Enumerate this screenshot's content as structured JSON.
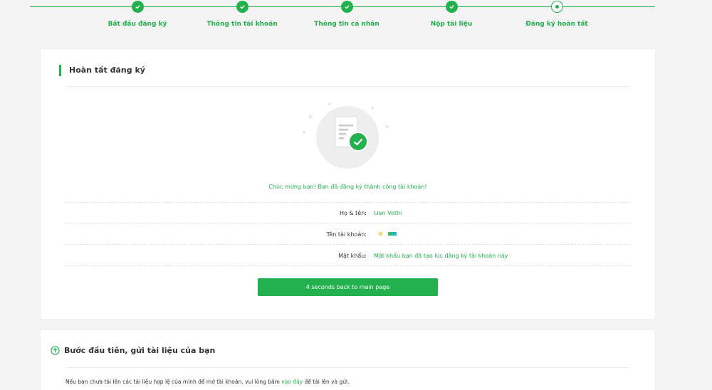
{
  "stepper": {
    "steps": [
      {
        "label": "Bắt đầu đăng ký",
        "status": "done"
      },
      {
        "label": "Thông tin tài khoản",
        "status": "done"
      },
      {
        "label": "Thông tin cá nhân",
        "status": "done"
      },
      {
        "label": "Nộp tài liệu",
        "status": "done"
      },
      {
        "label": "Đăng ký hoàn tất",
        "status": "current"
      }
    ]
  },
  "complete": {
    "title": "Hoàn tất đăng ký",
    "message": "Chúc mừng bạn! Bạn đã đăng ký thành công tài khoản!",
    "fields": [
      {
        "label": "Họ & tên:",
        "value": "Lien Vothi"
      },
      {
        "label": "Tên tài khoản:",
        "value": ""
      },
      {
        "label": "Mật khẩu:",
        "value": "Mật khẩu bạn đã tạo lúc đăng ký tài khoản này"
      }
    ],
    "redirect_button": "4 seconds back to main page"
  },
  "next_step": {
    "title": "Bước đầu tiên, gửi tài liệu của bạn",
    "note_before": "Nếu bạn chưa tải lên các tài liệu hợp lệ của mình để mở tài khoản, vui lòng bấm ",
    "note_link": "vào đây",
    "note_after": " để tải lên và gửi."
  },
  "colors": {
    "accent": "#22b14c"
  }
}
